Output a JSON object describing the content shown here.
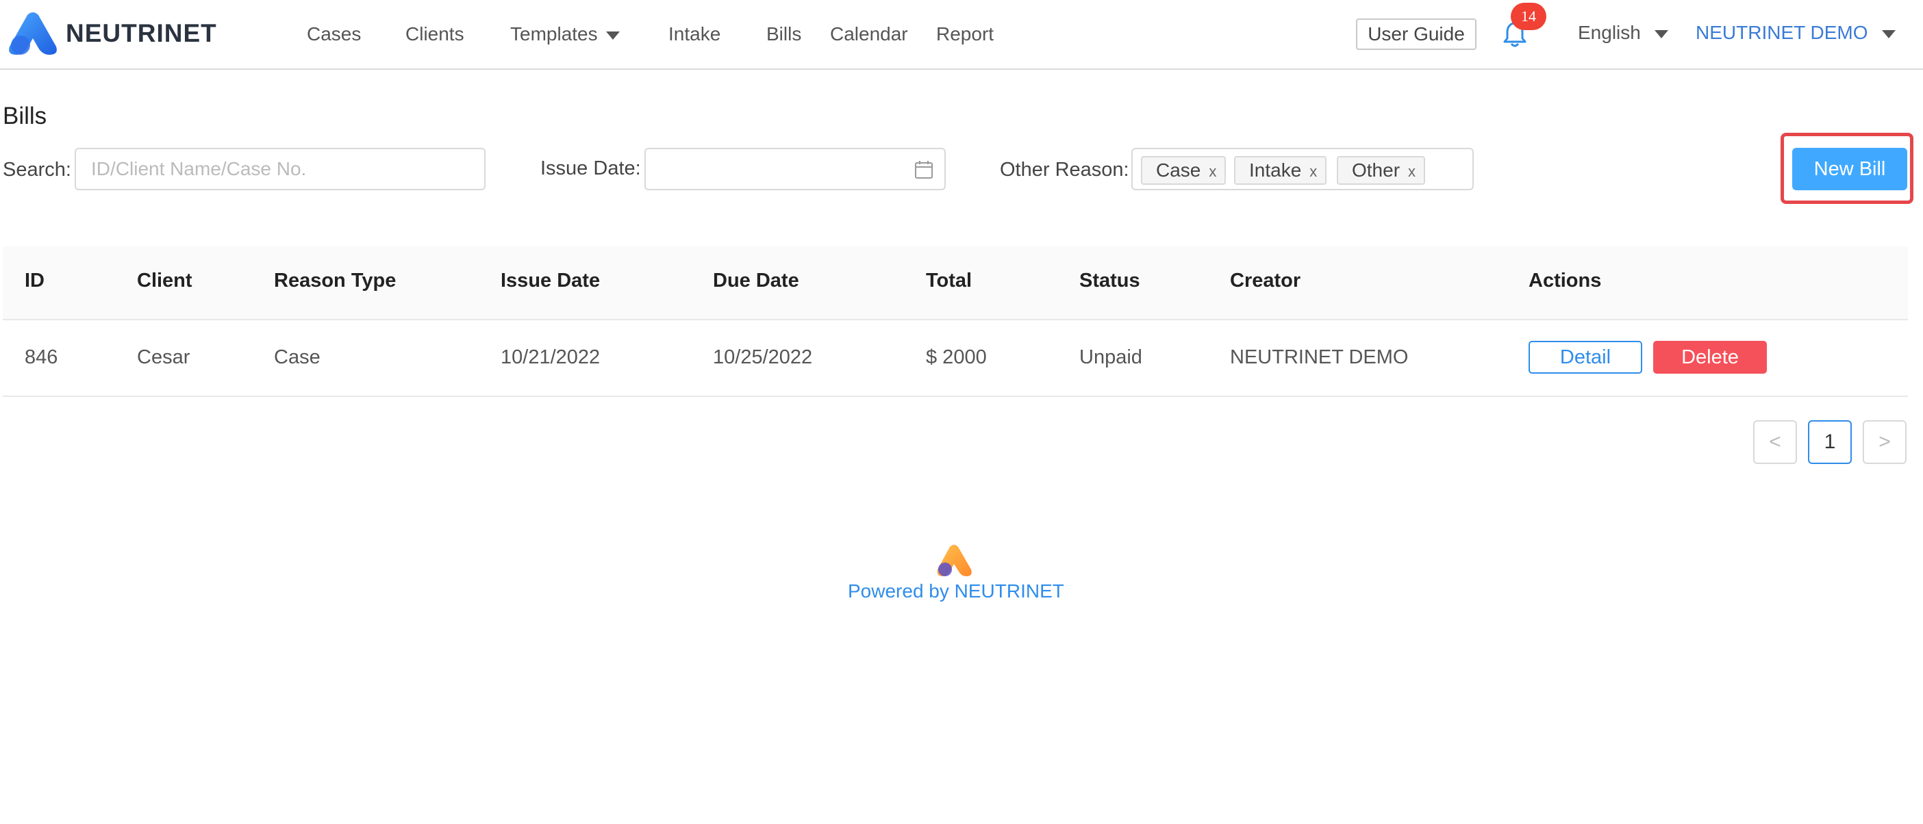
{
  "brand": {
    "name": "NEUTRINET"
  },
  "nav": {
    "items": [
      {
        "label": "Cases"
      },
      {
        "label": "Clients"
      },
      {
        "label": "Templates"
      },
      {
        "label": "Intake"
      },
      {
        "label": "Bills"
      },
      {
        "label": "Calendar"
      },
      {
        "label": "Report"
      }
    ]
  },
  "header": {
    "user_guide": "User Guide",
    "notification_count": "14",
    "language": "English",
    "user_name": "NEUTRINET DEMO"
  },
  "page": {
    "title": "Bills"
  },
  "filters": {
    "search_label": "Search:",
    "search_placeholder": "ID/Client Name/Case No.",
    "issue_date_label": "Issue Date:",
    "other_reason_label": "Other Reason:",
    "reason_tags": [
      "Case",
      "Intake",
      "Other"
    ],
    "tag_close": "x"
  },
  "actions": {
    "new_bill": "New Bill"
  },
  "table": {
    "columns": [
      "ID",
      "Client",
      "Reason Type",
      "Issue Date",
      "Due Date",
      "Total",
      "Status",
      "Creator",
      "Actions"
    ],
    "rows": [
      {
        "id": "846",
        "client": "Cesar",
        "reason_type": "Case",
        "issue_date": "10/21/2022",
        "due_date": "10/25/2022",
        "total": "$ 2000",
        "status": "Unpaid",
        "creator": "NEUTRINET DEMO",
        "detail_label": "Detail",
        "delete_label": "Delete"
      }
    ]
  },
  "pagination": {
    "prev": "<",
    "current": "1",
    "next": ">"
  },
  "footer": {
    "text": "Powered by NEUTRINET"
  },
  "colors": {
    "primary": "#40a9ff",
    "link": "#2f8dea",
    "danger": "#f5515a",
    "highlight": "#e5474b",
    "badge": "#f04134"
  }
}
